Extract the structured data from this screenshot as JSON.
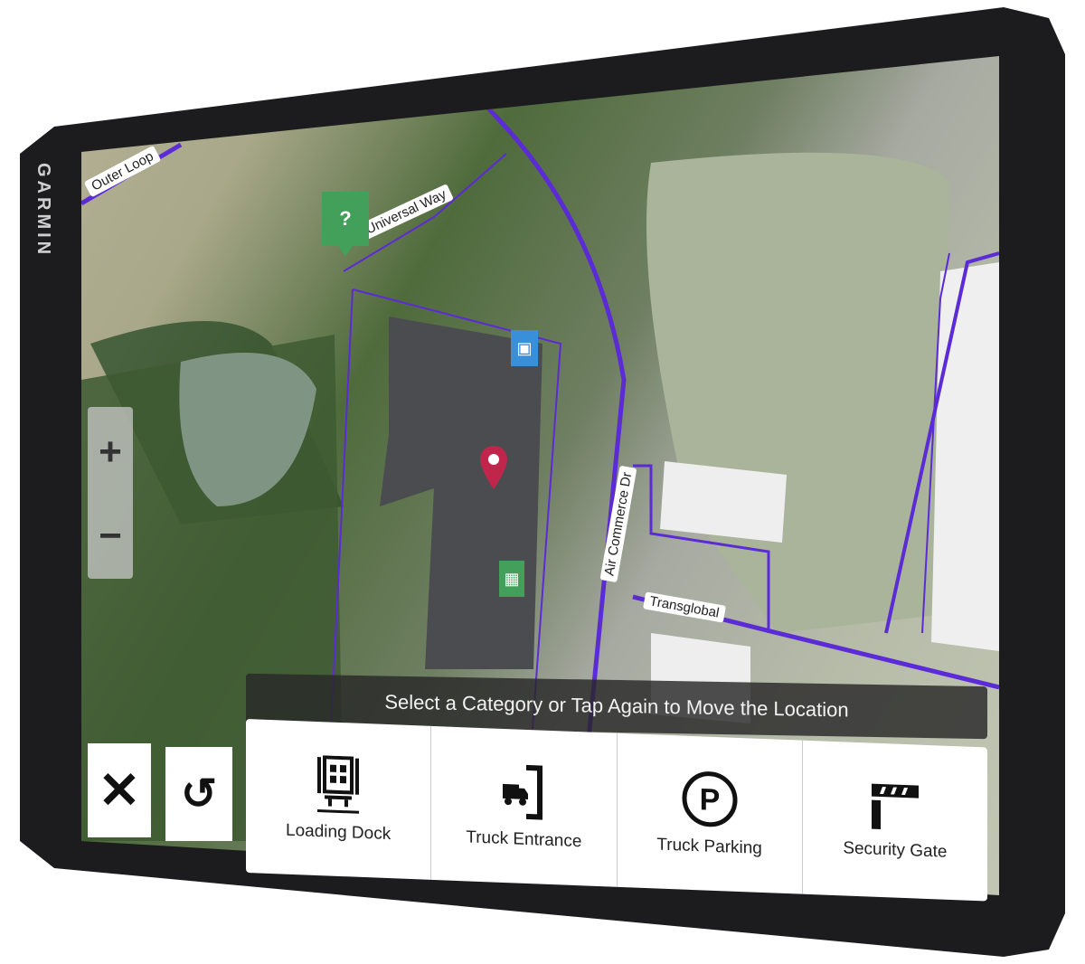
{
  "device": {
    "brand": "GARMIN"
  },
  "map": {
    "road_labels": [
      "Outer Loop",
      "Universal Way",
      "Air Commerce Dr",
      "Transglobal"
    ],
    "road_color": "#5b2bd6",
    "markers": [
      {
        "type": "unknown-category-marker",
        "label": "?",
        "color": "#43a05a"
      },
      {
        "type": "rv-marker",
        "color": "#3a8fd9"
      },
      {
        "type": "location-pin",
        "color": "#c0264b"
      },
      {
        "type": "loading-dock-marker",
        "color": "#43a05a"
      }
    ]
  },
  "zoom": {
    "in": "+",
    "out": "−"
  },
  "banner": "Select a Category or Tap Again to Move the Location",
  "buttons": {
    "cancel": "✕",
    "undo": "↺"
  },
  "categories": [
    {
      "label": "Loading Dock",
      "icon": "loading-dock-icon"
    },
    {
      "label": "Truck Entrance",
      "icon": "truck-entrance-icon"
    },
    {
      "label": "Truck Parking",
      "icon": "parking-icon"
    },
    {
      "label": "Security Gate",
      "icon": "security-gate-icon"
    }
  ]
}
